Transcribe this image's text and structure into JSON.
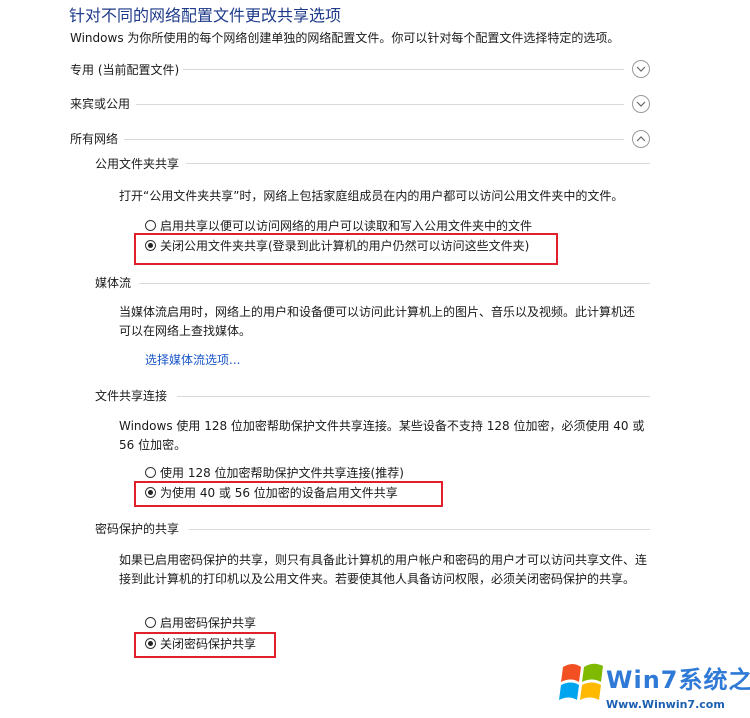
{
  "page": {
    "title": "针对不同的网络配置文件更改共享选项",
    "description": "Windows 为你所使用的每个网络创建单独的网络配置文件。你可以针对每个配置文件选择特定的选项。"
  },
  "profiles": {
    "private": {
      "label": "专用 (当前配置文件)",
      "icon": "chevron-down-icon"
    },
    "guest": {
      "label": "来宾或公用",
      "icon": "chevron-down-icon"
    },
    "all": {
      "label": "所有网络",
      "icon": "chevron-up-icon"
    }
  },
  "public_folder": {
    "heading": "公用文件夹共享",
    "text": "打开“公用文件夹共享”时，网络上包括家庭组成员在内的用户都可以访问公用文件夹中的文件。",
    "options": [
      {
        "label": "启用共享以便可以访问网络的用户可以读取和写入公用文件夹中的文件",
        "selected": false
      },
      {
        "label": "关闭公用文件夹共享(登录到此计算机的用户仍然可以访问这些文件夹)",
        "selected": true
      }
    ]
  },
  "media": {
    "heading": "媒体流",
    "text": "当媒体流启用时，网络上的用户和设备便可以访问此计算机上的图片、音乐以及视频。此计算机还可以在网络上查找媒体。",
    "link": "选择媒体流选项..."
  },
  "file_sharing": {
    "heading": "文件共享连接",
    "text": "Windows 使用 128 位加密帮助保护文件共享连接。某些设备不支持 128 位加密，必须使用 40 或 56 位加密。",
    "options": [
      {
        "label": "使用 128 位加密帮助保护文件共享连接(推荐)",
        "selected": false
      },
      {
        "label": "为使用 40 或 56 位加密的设备启用文件共享",
        "selected": true
      }
    ]
  },
  "password": {
    "heading": "密码保护的共享",
    "text": "如果已启用密码保护的共享，则只有具备此计算机的用户帐户和密码的用户才可以访问共享文件、连接到此计算机的打印机以及公用文件夹。若要使其他人具备访问权限，必须关闭密码保护的共享。",
    "options": [
      {
        "label": "启用密码保护共享",
        "selected": false
      },
      {
        "label": "关闭密码保护共享",
        "selected": true
      }
    ]
  },
  "colors": {
    "title": "#1e3a8a",
    "link": "#1a56c8",
    "highlight": "#e0202a"
  },
  "watermark": {
    "brand": "Win7系统之家",
    "url": "Www.Winwin7.com"
  }
}
